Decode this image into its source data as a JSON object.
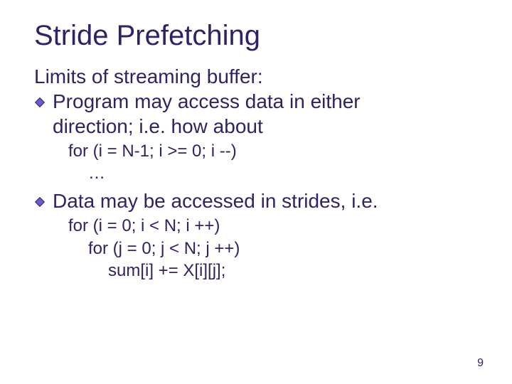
{
  "title": "Stride Prefetching",
  "intro": "Limits of streaming buffer:",
  "bullets": [
    {
      "text_a": "Program may access data in either",
      "text_b": "direction; i.e. how about",
      "code": [
        {
          "t": "for (i = N-1; i >= 0; i --)",
          "indent": 0
        },
        {
          "t": "…",
          "indent": 1
        }
      ]
    },
    {
      "text_a": "Data may be accessed in strides, i.e.",
      "text_b": "",
      "code": [
        {
          "t": "for (i = 0; i < N; i ++)",
          "indent": 0
        },
        {
          "t": "for (j = 0; j < N; j ++)",
          "indent": 1
        },
        {
          "t": "sum[i] += X[i][j];",
          "indent": 2
        }
      ]
    }
  ],
  "page_number": "9"
}
